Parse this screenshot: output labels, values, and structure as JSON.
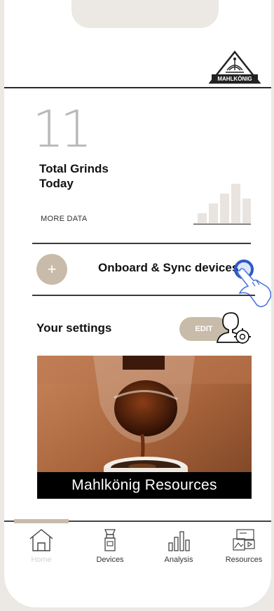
{
  "header": {
    "brand_logo": "MAHLKÖNIG"
  },
  "stats": {
    "count": "11",
    "label": "Total Grinds Today",
    "more_data": "MORE DATA",
    "mini_chart": {
      "type": "bar",
      "values": [
        2,
        4,
        6,
        8,
        5
      ]
    }
  },
  "onboard": {
    "plus_symbol": "+",
    "label": "Onboard & Sync devices"
  },
  "settings": {
    "title": "Your settings",
    "edit_label": "EDIT"
  },
  "resources_card": {
    "caption": "Mahlkönig Resources"
  },
  "nav": {
    "active_color": "#c9bba9",
    "items": [
      {
        "label": "Home",
        "icon": "home-icon",
        "active": true
      },
      {
        "label": "Devices",
        "icon": "grinder-icon",
        "active": false
      },
      {
        "label": "Analysis",
        "icon": "bar-chart-icon",
        "active": false
      },
      {
        "label": "Resources",
        "icon": "media-icon",
        "active": false
      }
    ]
  },
  "colors": {
    "accent": "#c9bba9",
    "touch_indicator": "#2b58c9"
  }
}
